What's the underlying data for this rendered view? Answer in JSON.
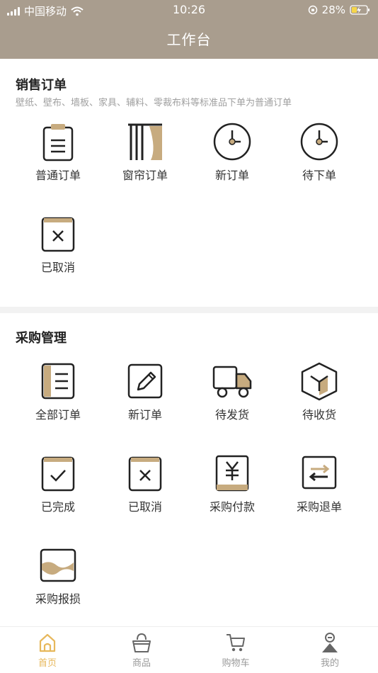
{
  "status": {
    "carrier": "中国移动",
    "time": "10:26",
    "battery": "28%"
  },
  "header": {
    "title": "工作台"
  },
  "sales": {
    "title": "销售订单",
    "subtitle": "壁纸、壁布、墙板、家具、辅料、零裁布料等标准品下单为普通订单",
    "items": [
      {
        "label": "普通订单",
        "icon": "clipboard-list-icon"
      },
      {
        "label": "窗帘订单",
        "icon": "curtain-icon"
      },
      {
        "label": "新订单",
        "icon": "clock-icon"
      },
      {
        "label": "待下单",
        "icon": "clock-icon"
      },
      {
        "label": "已取消",
        "icon": "clipboard-x-icon"
      }
    ]
  },
  "purchase": {
    "title": "采购管理",
    "items": [
      {
        "label": "全部订单",
        "icon": "notebook-icon"
      },
      {
        "label": "新订单",
        "icon": "edit-icon"
      },
      {
        "label": "待发货",
        "icon": "truck-icon"
      },
      {
        "label": "待收货",
        "icon": "box-icon"
      },
      {
        "label": "已完成",
        "icon": "clipboard-check-icon"
      },
      {
        "label": "已取消",
        "icon": "clipboard-x-icon"
      },
      {
        "label": "采购付款",
        "icon": "yuan-book-icon"
      },
      {
        "label": "采购退单",
        "icon": "exchange-icon"
      },
      {
        "label": "采购报损",
        "icon": "damaged-icon"
      }
    ]
  },
  "tabbar": {
    "items": [
      {
        "label": "首页",
        "active": true
      },
      {
        "label": "商品",
        "active": false
      },
      {
        "label": "购物车",
        "active": false
      },
      {
        "label": "我的",
        "active": false
      }
    ]
  },
  "colors": {
    "header": "#a99d8e",
    "accent": "#c7ab7f",
    "tab_active": "#e7b85c"
  }
}
